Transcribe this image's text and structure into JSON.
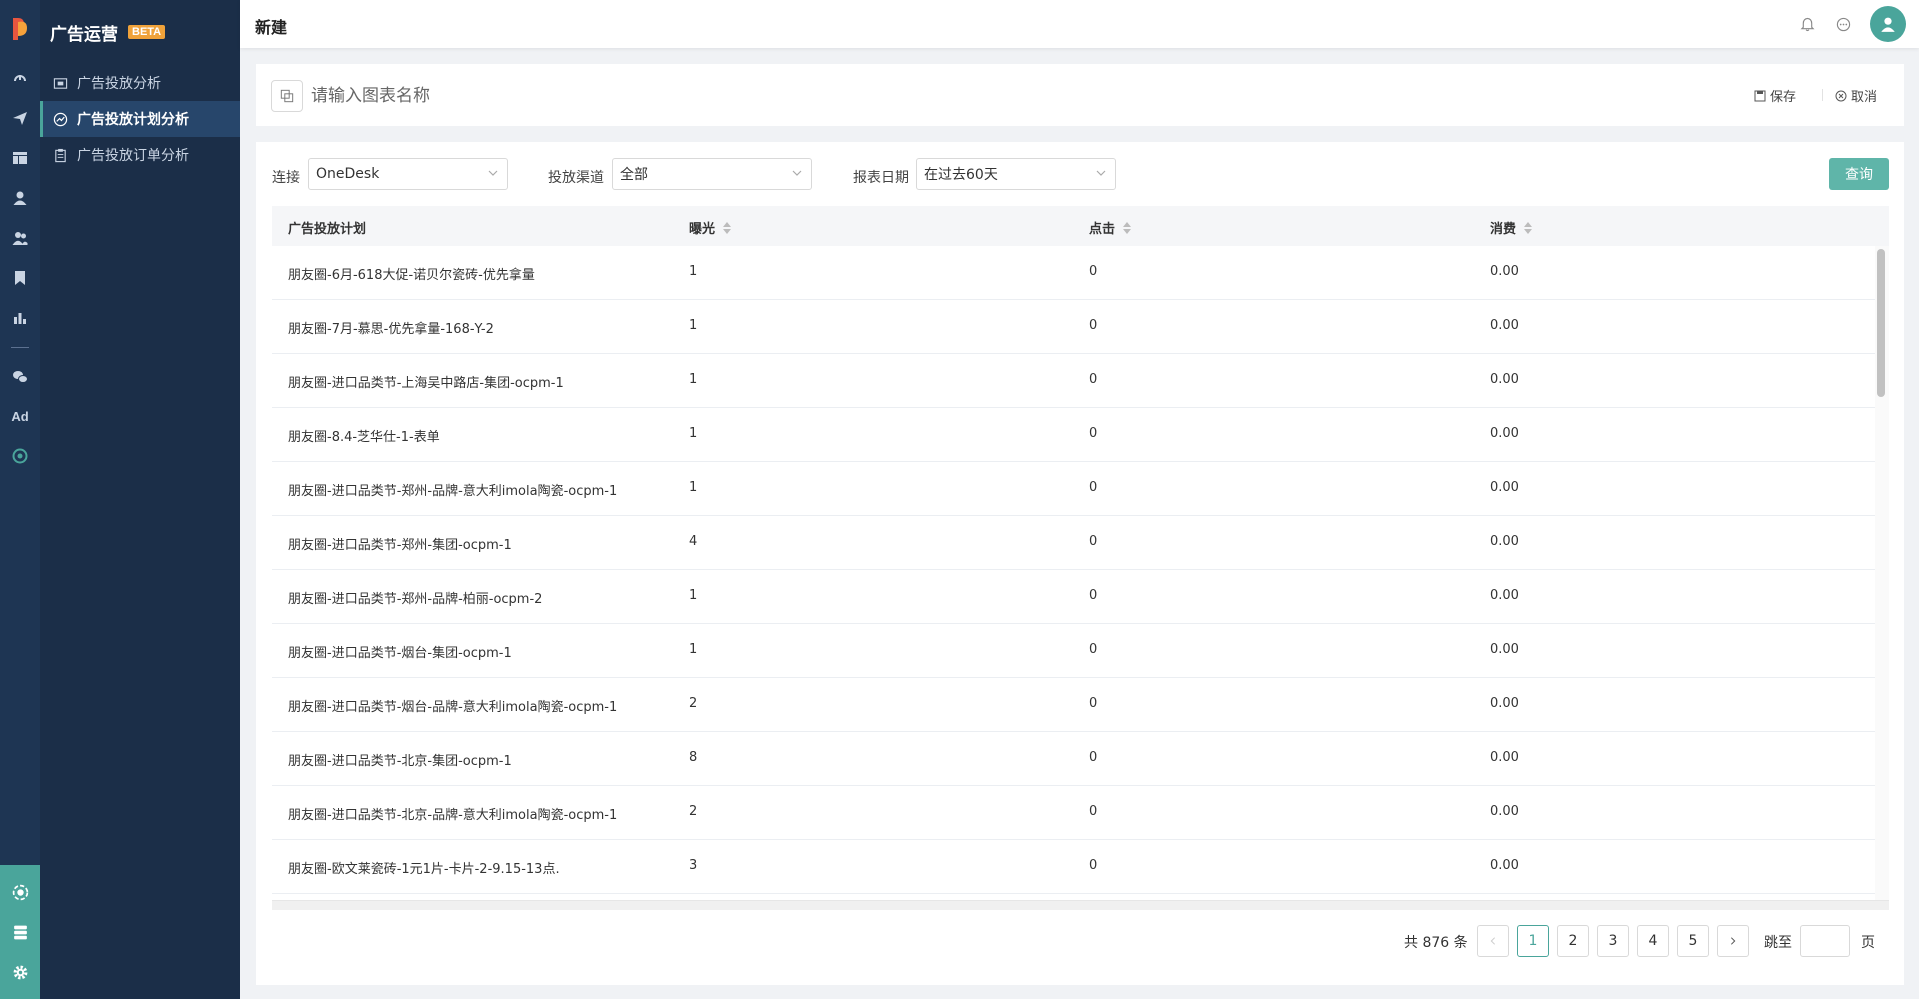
{
  "app": {
    "title": "广告运营",
    "badge": "BETA"
  },
  "sidebar": {
    "items": [
      {
        "label": "广告投放分析",
        "icon": "report-icon",
        "active": false
      },
      {
        "label": "广告投放计划分析",
        "icon": "trend-icon",
        "active": true
      },
      {
        "label": "广告投放订单分析",
        "icon": "clipboard-icon",
        "active": false
      }
    ]
  },
  "rail": {
    "ad_label": "Ad"
  },
  "topbar": {
    "title": "新建"
  },
  "namebar": {
    "placeholder": "请输入图表名称",
    "save_label": "保存",
    "cancel_label": "取消"
  },
  "filters": {
    "connection_label": "连接",
    "connection_value": "OneDesk",
    "channel_label": "投放渠道",
    "channel_value": "全部",
    "date_label": "报表日期",
    "date_value": "在过去60天",
    "query_label": "查询"
  },
  "table": {
    "columns": [
      "广告投放计划",
      "曝光",
      "点击",
      "消费"
    ],
    "rows": [
      [
        "朋友圈-6月-618大促-诺贝尔瓷砖-优先拿量",
        "1",
        "0",
        "0.00"
      ],
      [
        "朋友圈-7月-慕思-优先拿量-168-Y-2",
        "1",
        "0",
        "0.00"
      ],
      [
        "朋友圈-进口品类节-上海吴中路店-集团-ocpm-1",
        "1",
        "0",
        "0.00"
      ],
      [
        "朋友圈-8.4-芝华仕-1-表单",
        "1",
        "0",
        "0.00"
      ],
      [
        "朋友圈-进口品类节-郑州-品牌-意大利imola陶瓷-ocpm-1",
        "1",
        "0",
        "0.00"
      ],
      [
        "朋友圈-进口品类节-郑州-集团-ocpm-1",
        "4",
        "0",
        "0.00"
      ],
      [
        "朋友圈-进口品类节-郑州-品牌-柏丽-ocpm-2",
        "1",
        "0",
        "0.00"
      ],
      [
        "朋友圈-进口品类节-烟台-集团-ocpm-1",
        "1",
        "0",
        "0.00"
      ],
      [
        "朋友圈-进口品类节-烟台-品牌-意大利imola陶瓷-ocpm-1",
        "2",
        "0",
        "0.00"
      ],
      [
        "朋友圈-进口品类节-北京-集团-ocpm-1",
        "8",
        "0",
        "0.00"
      ],
      [
        "朋友圈-进口品类节-北京-品牌-意大利imola陶瓷-ocpm-1",
        "2",
        "0",
        "0.00"
      ],
      [
        "朋友圈-欧文莱瓷砖-1元1片-卡片-2-9.15-13点.",
        "3",
        "0",
        "0.00"
      ]
    ]
  },
  "pagination": {
    "total_text": "共 876 条",
    "pages": [
      "1",
      "2",
      "3",
      "4",
      "5"
    ],
    "current": "1",
    "jump_label": "跳至",
    "page_suffix": "页"
  },
  "colors": {
    "accent": "#4aa59b",
    "sidebar": "#1b2e48",
    "rail": "#1e3553",
    "badge": "#f0a23a"
  }
}
